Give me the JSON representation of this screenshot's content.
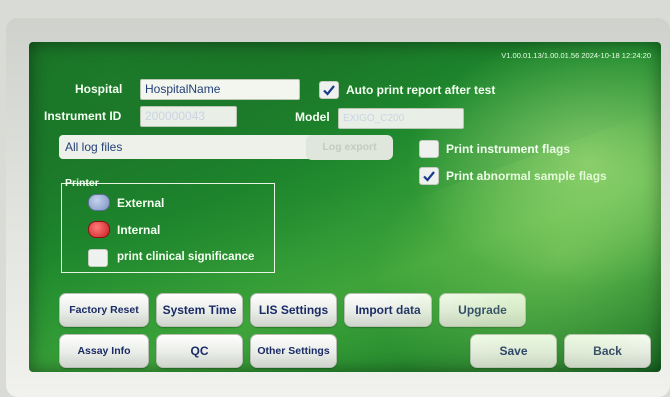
{
  "header": {
    "version": "V1.00.01.13/1.00.01.56  2024-10-18 12:24:20"
  },
  "hospital": {
    "label": "Hospital",
    "value": "HospitalName"
  },
  "instrument": {
    "label": "Instrument ID",
    "value": "200000043"
  },
  "model": {
    "label": "Model",
    "value": "EXIGO_C200"
  },
  "auto_print": {
    "label": "Auto print report after test",
    "checked": true
  },
  "log": {
    "selected": "All log files",
    "export_label": "Log export"
  },
  "print_instrument_flags": {
    "label": "Print instrument flags",
    "checked": false
  },
  "print_abnormal_flags": {
    "label": "Print abnormal sample flags",
    "checked": true
  },
  "printer": {
    "title": "Printer",
    "options": [
      {
        "label": "External",
        "selected": false
      },
      {
        "label": "Internal",
        "selected": true
      }
    ],
    "clinical": {
      "label": "print clinical significance",
      "checked": false
    }
  },
  "buttons": {
    "factory_reset": "Factory Reset",
    "system_time": "System Time",
    "lis_settings": "LIS Settings",
    "import_data": "Import data",
    "upgrade": "Upgrade",
    "assay_info": "Assay Info",
    "qc": "QC",
    "other_settings": "Other Settings",
    "save": "Save",
    "back": "Back"
  },
  "colors": {
    "screen_green": "#1f8a2e",
    "text_navy": "#1a2b66",
    "radio_selected": "#d8262a",
    "radio_unselected": "#8ea3c9"
  }
}
